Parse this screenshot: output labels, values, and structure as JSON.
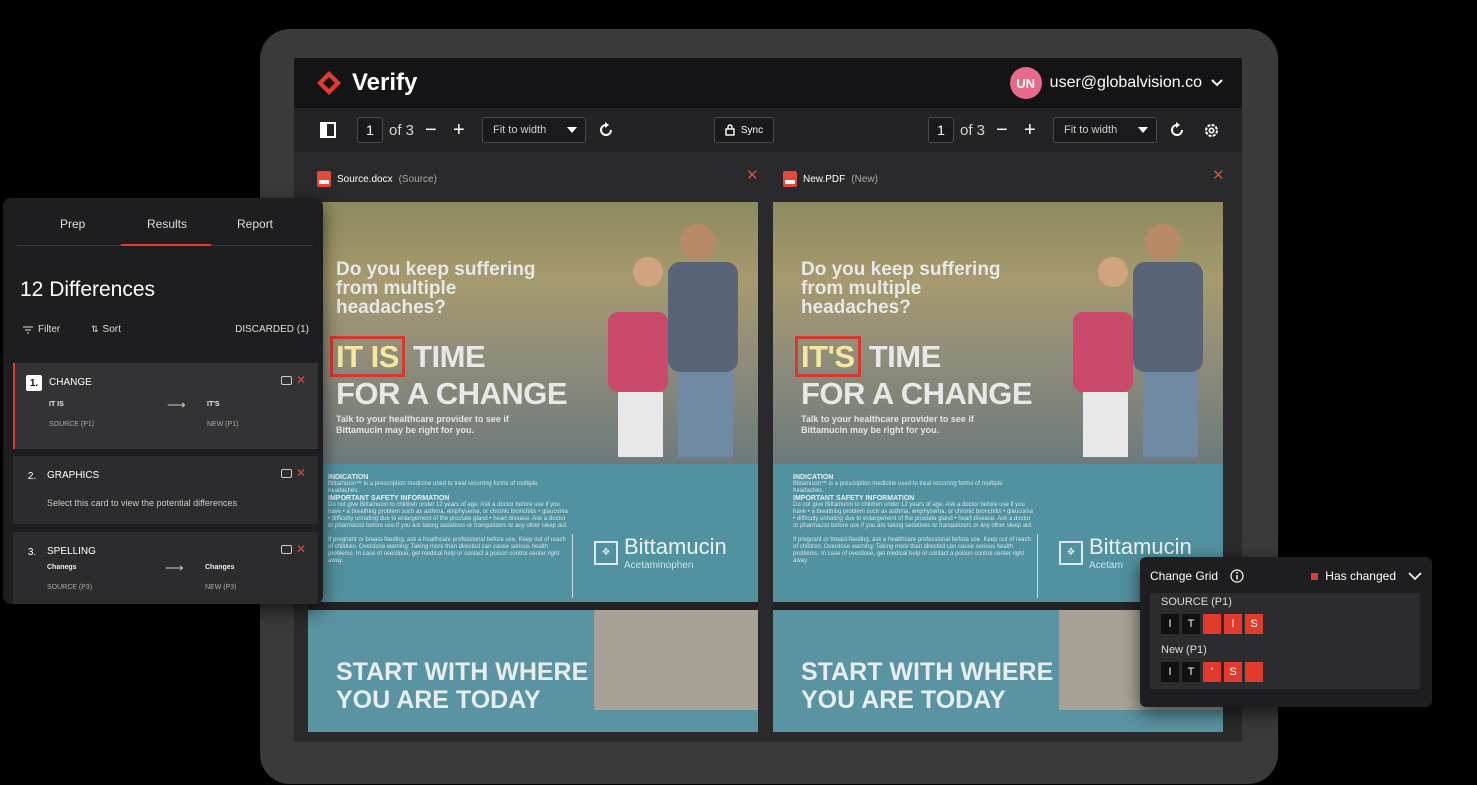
{
  "app": {
    "brand": "Verify",
    "user_initials": "UN",
    "user_email": "user@globalvision.co"
  },
  "toolbar": {
    "left_page": "1",
    "left_of": "of 3",
    "left_fit": "Fit to width",
    "sync_label": "Sync",
    "right_page": "1",
    "right_of": "of 3",
    "right_fit": "Fit to width"
  },
  "documents": {
    "source": {
      "name": "Source.docx",
      "tag": "(Source)"
    },
    "new": {
      "name": "New.PDF",
      "tag": "(New)"
    }
  },
  "flyer": {
    "headline_small": "Do you keep suffering from multiple headaches?",
    "source_highlight": "IT IS",
    "new_highlight": "IT'S",
    "headline_rest1": "TIME",
    "headline_rest2": "FOR A CHANGE",
    "tagline": "Talk to your healthcare provider to see if Bittamucin may be right for you.",
    "indication_title": "INDICATION",
    "indication_text": "Bittamucin™ is a prescription medicine used to treat recurring forms of multiple headaches.",
    "safety_title": "IMPORTANT SAFETY INFORMATION",
    "safety_text": "Do not give Bittamucin to children under 12 years of age. Ask a doctor before use if you have • a breathing problem such as asthma, emphysema, or chronic bronchitis • glaucoma • difficulty urinating due to enlargement of the prostate gland • heart disease. Ask a doctor or pharmacist before use if you are taking sedatives or tranquilizers or any other sleep aid.",
    "warning_text": "If pregnant or breast-feeding, ask a healthcare professional before use. Keep out of reach of children. Overdose warning: Taking more than directed can cause serious health problems. In case of overdose, get medical help or contact a poison control center right away.",
    "brand_name": "Bittamucin",
    "brand_sub": "Acetaminophen",
    "brand_name_partial": "Bittamucin",
    "brand_sub_partial": "Acetam",
    "bottom_headline": "START WITH WHERE YOU ARE TODAY"
  },
  "panel": {
    "tabs": [
      "Prep",
      "Results",
      "Report"
    ],
    "diff_count": "12 Differences",
    "filter_label": "Filter",
    "sort_label": "Sort",
    "discarded_label": "DISCARDED (1)",
    "cards": [
      {
        "num": "1.",
        "type": "CHANGE",
        "from": "IT IS",
        "to": "IT'S",
        "from_loc": "SOURCE (P1)",
        "to_loc": "NEW (P1)"
      },
      {
        "num": "2.",
        "type": "GRAPHICS",
        "desc": "Select this card to view the potential differences"
      },
      {
        "num": "3.",
        "type": "SPELLING",
        "from": "Chanegs",
        "to": "Changes",
        "from_loc": "SOURCE (P3)",
        "to_loc": "NEW (P3)"
      }
    ]
  },
  "change_grid": {
    "title": "Change Grid",
    "legend": "Has changed",
    "source_label": "SOURCE (P1)",
    "new_label": "New (P1)",
    "source_cells": [
      {
        "ch": "I",
        "changed": false
      },
      {
        "ch": "T",
        "changed": false
      },
      {
        "ch": "",
        "changed": true
      },
      {
        "ch": "I",
        "changed": true
      },
      {
        "ch": "S",
        "changed": true
      }
    ],
    "new_cells": [
      {
        "ch": "I",
        "changed": false
      },
      {
        "ch": "T",
        "changed": false
      },
      {
        "ch": "'",
        "changed": true
      },
      {
        "ch": "S",
        "changed": true
      },
      {
        "ch": "",
        "changed": true
      }
    ],
    "accent_color": "#e23b2e"
  }
}
